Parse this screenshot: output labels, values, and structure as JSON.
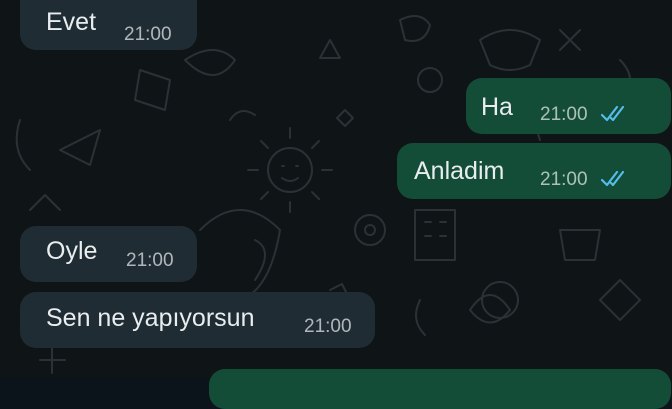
{
  "chat": {
    "messages": [
      {
        "direction": "incoming",
        "text": "Evet",
        "time": "21:00"
      },
      {
        "direction": "outgoing",
        "text": "Ha",
        "time": "21:00",
        "status": "read"
      },
      {
        "direction": "outgoing",
        "text": "Anladim",
        "time": "21:00",
        "status": "read"
      },
      {
        "direction": "incoming",
        "text": "Oyle",
        "time": "21:00"
      },
      {
        "direction": "incoming",
        "text": "Sen ne yapıyorsun",
        "time": "21:00"
      }
    ]
  },
  "colors": {
    "background": "#0f1417",
    "incoming_bubble": "#1f2c33",
    "outgoing_bubble": "#144d37",
    "read_ticks": "#53bdeb",
    "text": "#e9edef"
  },
  "icons": {
    "read_receipt": "double-check-icon"
  }
}
